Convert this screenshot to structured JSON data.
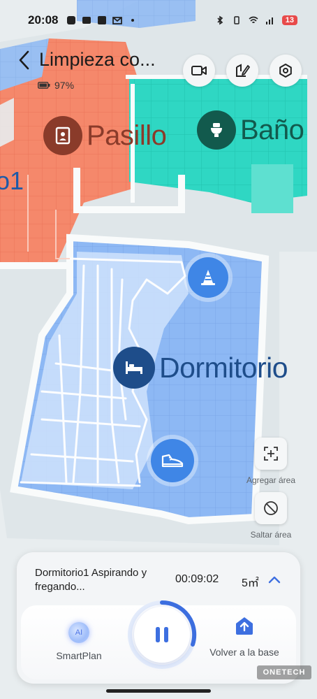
{
  "status_bar": {
    "time": "20:08",
    "battery_level": "13"
  },
  "header": {
    "title": "Limpieza co...",
    "battery": "97%"
  },
  "rooms": {
    "pasillo": "Pasillo",
    "bano": "Baño",
    "dormitorio": "Dormitorio",
    "left_partial": "o1"
  },
  "side_actions": {
    "add_area": "Agregar área",
    "skip_area": "Saltar área"
  },
  "task": {
    "description": "Dormitorio1 Aspirando y fregando...",
    "elapsed": "00:09:02",
    "area": "5㎡"
  },
  "controls": {
    "smartplan_label": "SmartPlan",
    "ai_badge": "AI",
    "return_label": "Volver a la base"
  },
  "watermark": "ONETECH",
  "colors": {
    "pasillo": "#f4856a",
    "bano": "#2fd5c2",
    "dormitorio": "#8cb8f5",
    "accent": "#3d6fe0"
  }
}
